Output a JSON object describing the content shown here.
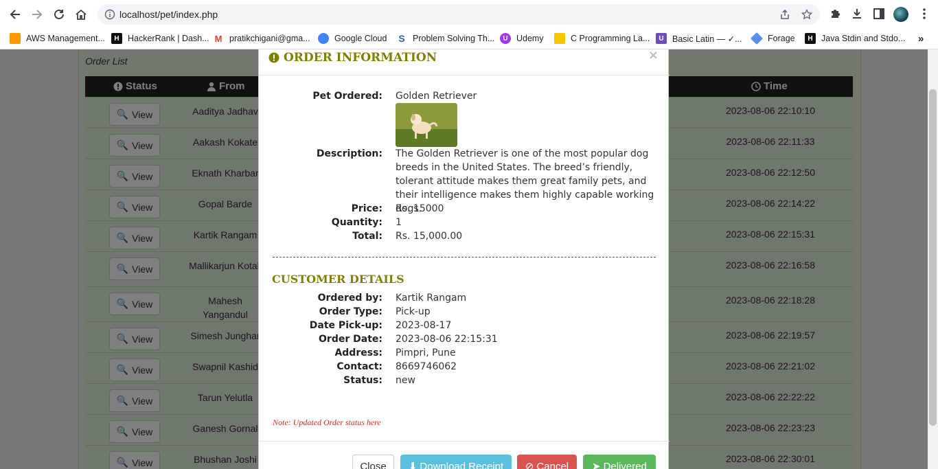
{
  "browser": {
    "url": "localhost/pet/index.php",
    "bookmarks": [
      {
        "label": "AWS Management...",
        "color": "#ff9900"
      },
      {
        "label": "HackerRank | Dash...",
        "color": "#111111"
      },
      {
        "label": "pratikchigani@gma...",
        "color": "#ea4335"
      },
      {
        "label": "Google Cloud",
        "color": "#4285f4"
      },
      {
        "label": "Problem Solving Th...",
        "color": "#2f5fd0"
      },
      {
        "label": "Udemy",
        "color": "#a435f0"
      },
      {
        "label": "C Programming La...",
        "color": "#f7c600"
      },
      {
        "label": "Basic Latin — ✓...",
        "color": "#6b4fbb"
      },
      {
        "label": "Forage",
        "color": "#5b8def"
      },
      {
        "label": "Java Stdin and Stdo...",
        "color": "#111111"
      }
    ]
  },
  "page": {
    "panel_title": "Order List",
    "headers": {
      "status": "Status",
      "from": "From",
      "time": "Time"
    },
    "view_label": "View",
    "rows": [
      {
        "from": "Aaditya Jadhav",
        "time": "2023-08-06 22:10:10"
      },
      {
        "from": "Aakash Kokate",
        "time": "2023-08-06 22:11:33"
      },
      {
        "from": "Eknath Kharbar",
        "time": "2023-08-06 22:12:50"
      },
      {
        "from": "Gopal Barde",
        "time": "2023-08-06 22:14:22"
      },
      {
        "from": "Kartik Rangam",
        "time": "2023-08-06 22:15:31"
      },
      {
        "from": "Mallikarjun Kotali",
        "time": "2023-08-06 22:16:58"
      },
      {
        "from": "Mahesh Yangandul",
        "time": "2023-08-06 22:18:28"
      },
      {
        "from": "Simesh Junghar",
        "time": "2023-08-06 22:19:57"
      },
      {
        "from": "Swapnil Kashid",
        "time": "2023-08-06 22:21:02"
      },
      {
        "from": "Tarun Yelutla",
        "time": "2023-08-06 22:22:22"
      },
      {
        "from": "Ganesh Gornal",
        "time": "2023-08-06 22:23:23"
      },
      {
        "from": "Bhushan Joshi",
        "time": "2023-08-06 22:30:01"
      }
    ]
  },
  "modal": {
    "title": "ORDER INFORMATION",
    "pet_ordered_label": "Pet Ordered:",
    "pet_ordered": "Golden Retriever",
    "description_label": "Description:",
    "description": "The Golden Retriever is one of the most popular dog breeds in the United States. The breed’s friendly, tolerant attitude makes them great family pets, and their intelligence makes them highly capable working dogs.",
    "price_label": "Price:",
    "price": "Rs. 15000",
    "quantity_label": "Quantity:",
    "quantity": "1",
    "total_label": "Total:",
    "total": "Rs. 15,000.00",
    "customer_title": "CUSTOMER DETAILS",
    "ordered_by_label": "Ordered by:",
    "ordered_by": "Kartik Rangam",
    "order_type_label": "Order Type:",
    "order_type": "Pick-up",
    "date_pickup_label": "Date Pick-up:",
    "date_pickup": "2023-08-17",
    "order_date_label": "Order Date:",
    "order_date": "2023-08-06 22:15:31",
    "address_label": "Address:",
    "address": "Pimpri, Pune",
    "contact_label": "Contact:",
    "contact": "8669746062",
    "status_label": "Status:",
    "status": "new",
    "note": "Note: Updated Order status here",
    "buttons": {
      "close": "Close",
      "download": "Download Receipt",
      "cancel": "Cancel",
      "delivered": "Delivered"
    }
  }
}
